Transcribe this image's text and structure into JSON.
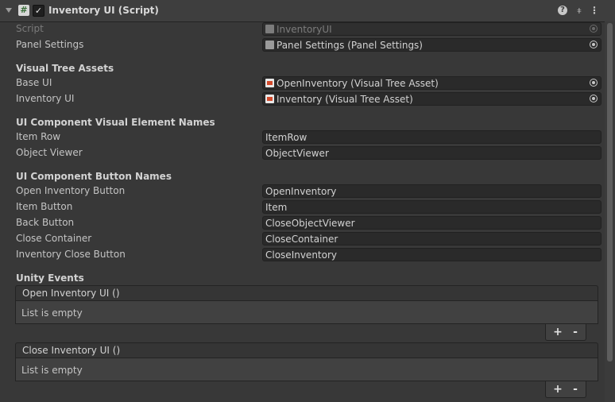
{
  "header": {
    "title": "Inventory UI (Script)",
    "script_icon": "#",
    "enabled_check": "✓",
    "help": "?",
    "presets": "⧧",
    "menu": "⋮"
  },
  "fields": {
    "script": {
      "label": "Script",
      "value": "InventoryUI"
    },
    "panel_settings": {
      "label": "Panel Settings",
      "value": "Panel Settings (Panel Settings)"
    },
    "section_visual_tree": "Visual Tree Assets",
    "base_ui": {
      "label": "Base UI",
      "value": "OpenInventory (Visual Tree Asset)"
    },
    "inventory_ui": {
      "label": "Inventory UI",
      "value": "Inventory (Visual Tree Asset)"
    },
    "section_element_names": "UI Component Visual Element Names",
    "item_row": {
      "label": "Item Row",
      "value": "ItemRow"
    },
    "object_viewer": {
      "label": "Object Viewer",
      "value": "ObjectViewer"
    },
    "section_button_names": "UI Component Button Names",
    "open_inventory_button": {
      "label": "Open Inventory Button",
      "value": "OpenInventory"
    },
    "item_button": {
      "label": "Item Button",
      "value": "Item"
    },
    "back_button": {
      "label": "Back Button",
      "value": "CloseObjectViewer"
    },
    "close_container": {
      "label": "Close Container",
      "value": "CloseContainer"
    },
    "inventory_close_button": {
      "label": "Inventory Close Button",
      "value": "CloseInventory"
    },
    "section_events": "Unity Events"
  },
  "events": [
    {
      "title": "Open Inventory UI ()",
      "empty_text": "List is empty",
      "add": "+",
      "remove": "-"
    },
    {
      "title": "Close Inventory UI ()",
      "empty_text": "List is empty",
      "add": "+",
      "remove": "-"
    }
  ]
}
